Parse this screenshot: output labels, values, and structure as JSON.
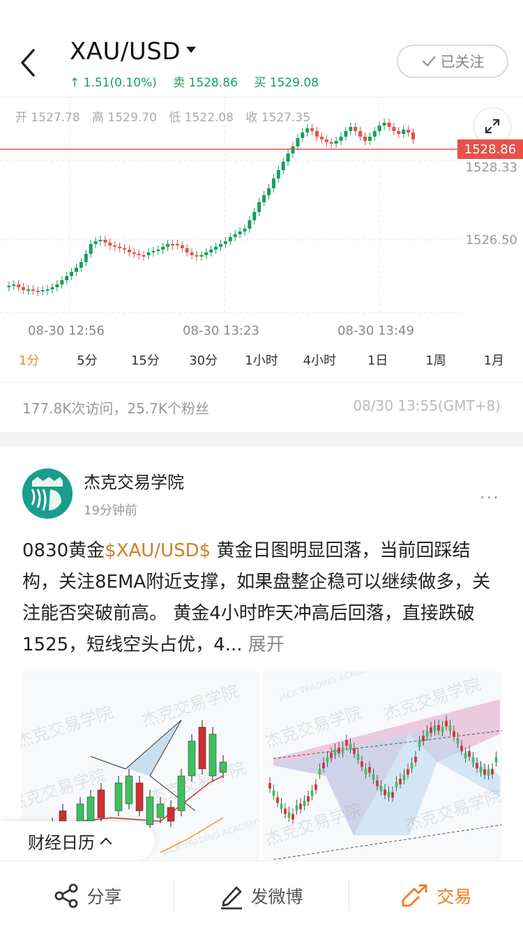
{
  "header": {
    "symbol": "XAU/USD",
    "change": "↑ 1.51(0.10%)",
    "sell": "卖 1528.86",
    "buy": "买 1529.08",
    "follow_label": "已关注",
    "quote_color": "#14a05a"
  },
  "chart": {
    "ohlc": {
      "open": "开 1527.78",
      "high": "高 1529.70",
      "low": "低 1522.08",
      "close": "收 1527.35"
    },
    "current_price": "1528.86",
    "y_labels": [
      "1528.33",
      "1526.50"
    ],
    "x_labels": [
      "08-30 12:56",
      "08-30 13:23",
      "08-30 13:49"
    ],
    "up_color": "#14a05a",
    "down_color": "#e8504a"
  },
  "chart_data": {
    "type": "candlestick",
    "y_ticks": [
      1528.33,
      1526.5
    ],
    "current_price": 1528.86,
    "x_ticks": [
      "08-30 12:56",
      "08-30 13:23",
      "08-30 13:49"
    ]
  },
  "timeframes": [
    "1分",
    "5分",
    "15分",
    "30分",
    "1小时",
    "4小时",
    "1日",
    "1周",
    "1月"
  ],
  "active_timeframe": 0,
  "stats": {
    "visits_fans": "177.8K次访问，25.7K个粉丝",
    "timestamp": "08/30 13:55(GMT+8)"
  },
  "post": {
    "author": "杰克交易学院",
    "time": "19分钟前",
    "text_before": "0830黄金",
    "tag": "$XAU/USD$",
    "text_after": " 黄金日图明显回落，当前回踩结构，关注8EMA附近支撑，如果盘整企稳可以继续做多，关注能否突破前高。 黄金4小时昨天冲高后回落，直接跌破1525，短线空头占优，4...",
    "expand_label": " 展开",
    "watermark": "杰克交易学院",
    "watermark_sub": "JACK TRADING ACADEMY"
  },
  "calendar": {
    "label": "财经日历"
  },
  "bottom_bar": {
    "share": "分享",
    "weibo": "发微博",
    "trade": "交易"
  }
}
